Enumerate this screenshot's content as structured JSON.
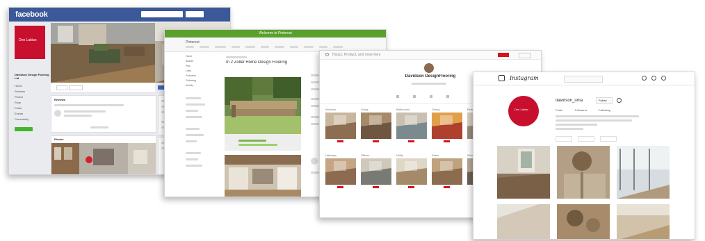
{
  "facebook": {
    "logo": "facebook",
    "page_name": "Davidson Design Flooring Ltd",
    "brand_short": "Den Labian",
    "nav": [
      "Home",
      "Reviews",
      "Photos",
      "Shop",
      "Posts",
      "Events",
      "Community"
    ],
    "about_label": "Reviews",
    "photos_label": "Photos"
  },
  "pinterest": {
    "banner": "Welcome to Pinterest",
    "brand": "Pinterest",
    "board_title": "In 2 Zoller Home Design Flooring",
    "left_labels": [
      "Home",
      "Boards",
      "Pins",
      "Likes",
      "Followers",
      "Following",
      "Activity"
    ]
  },
  "houzz": {
    "search_text": "Houzz, Product, and more here",
    "profile_name": "Davidson DesignFlooring",
    "boards": [
      "Kitchens",
      "Living",
      "Bathrooms",
      "Dining",
      "Bedroom",
      "Outdoor",
      "Hallways",
      "Offices",
      "Utility",
      "Stairs",
      "Windows",
      "Exterior"
    ]
  },
  "instagram": {
    "logo": "Instagram",
    "handle": "davidson_uma",
    "follow_label": "Follow",
    "stats": [
      "Posts",
      "Followers",
      "Following"
    ]
  },
  "colors": {
    "facebook_blue": "#3b5998",
    "brand_red": "#c8102e",
    "pinterest_green": "#5aa02c",
    "houzz_red": "#d5131a"
  },
  "icons": [
    "camera-icon",
    "gear-icon",
    "search-icon",
    "heart-icon",
    "compass-icon"
  ]
}
